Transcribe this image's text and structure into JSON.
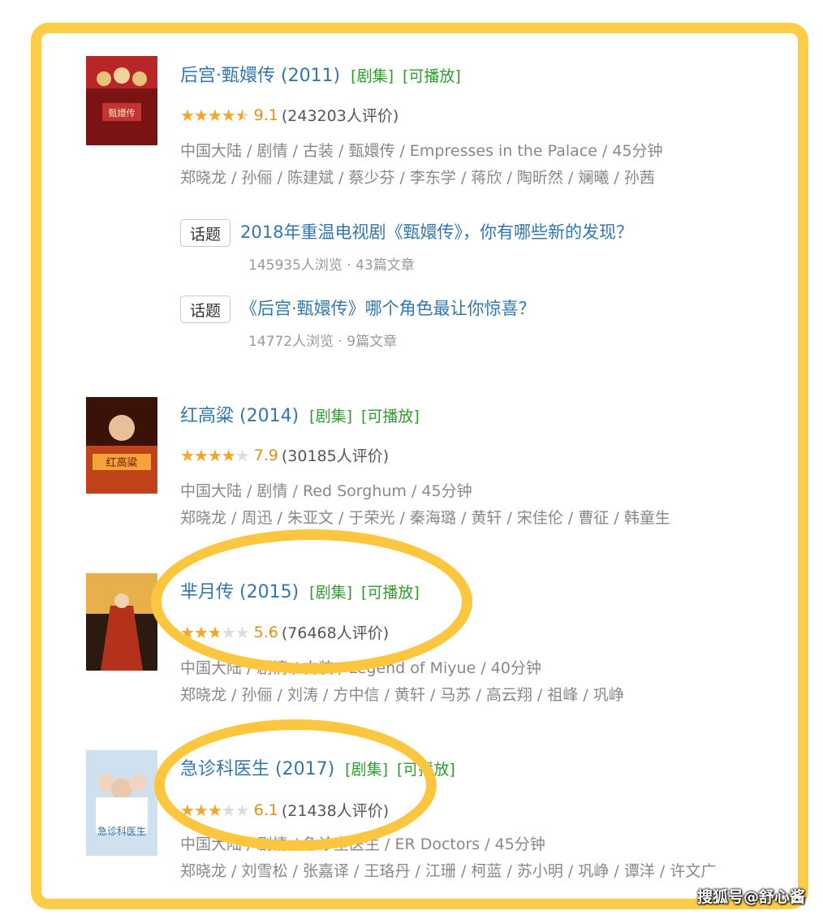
{
  "items": [
    {
      "title": "后宫·甄嬛传 (2011)",
      "tag1": "[剧集]",
      "tag2": "[可播放]",
      "rating": 0.91,
      "score": "9.1",
      "count": "(243203人评价)",
      "meta1": "中国大陆 / 剧情 / 古装 / 甄嬛传 / Empresses in the Palace / 45分钟",
      "meta2": "郑晓龙 / 孙俪 / 陈建斌 / 蔡少芬 / 李东学 / 蒋欣 / 陶昕然 / 斓曦 / 孙茜",
      "poster_colors": [
        "#7a1412",
        "#b8262a",
        "#e9c27a"
      ]
    },
    {
      "title": "红高粱 (2014)",
      "tag1": "[剧集]",
      "tag2": "[可播放]",
      "rating": 0.79,
      "score": "7.9",
      "count": "(30185人评价)",
      "meta1": "中国大陆 / 剧情 / Red Sorghum / 45分钟",
      "meta2": "郑晓龙 / 周迅 / 朱亚文 / 于荣光 / 秦海璐 / 黄轩 / 宋佳伦 / 曹征 / 韩童生",
      "poster_colors": [
        "#3a1208",
        "#c0431a",
        "#f2a33a"
      ]
    },
    {
      "title": "芈月传 (2015)",
      "tag1": "[剧集]",
      "tag2": "[可播放]",
      "rating": 0.56,
      "score": "5.6",
      "count": "(76468人评价)",
      "meta1": "中国大陆 / 剧情 / 古装 / Legend of Miyue / 40分钟",
      "meta2": "郑晓龙 / 孙俪 / 刘涛 / 方中信 / 黄轩 / 马苏 / 高云翔 / 祖峰 / 巩峥",
      "poster_colors": [
        "#2a1a10",
        "#b4321c",
        "#e8b04a"
      ]
    },
    {
      "title": "急诊科医生 (2017)",
      "tag1": "[剧集]",
      "tag2": "[可播放]",
      "rating": 0.61,
      "score": "6.1",
      "count": "(21438人评价)",
      "meta1": "中国大陆 / 剧情 / 急诊室医生 / ER Doctors / 45分钟",
      "meta2": "郑晓龙 / 刘雪松 / 张嘉译 / 王珞丹 / 江珊 / 柯蓝 / 苏小明 / 巩峥 / 谭洋 / 许文广",
      "poster_colors": [
        "#cfe0ee",
        "#ffffff",
        "#2a6fb0"
      ]
    }
  ],
  "topics": [
    {
      "badge": "话题",
      "title": "2018年重温电视剧《甄嬛传》，你有哪些新的发现？",
      "stats": "145935人浏览 · 43篇文章"
    },
    {
      "badge": "话题",
      "title": "《后宫·甄嬛传》哪个角色最让你惊喜？",
      "stats": "14772人浏览 · 9篇文章"
    }
  ],
  "stars_glyph": "★★★★★",
  "watermark": "搜狐号@舒心酱",
  "colors": {
    "frame": "#fdcd47",
    "link": "#3377aa",
    "tag": "#2f9c2f",
    "star": "#f5a623",
    "score": "#e09015"
  }
}
